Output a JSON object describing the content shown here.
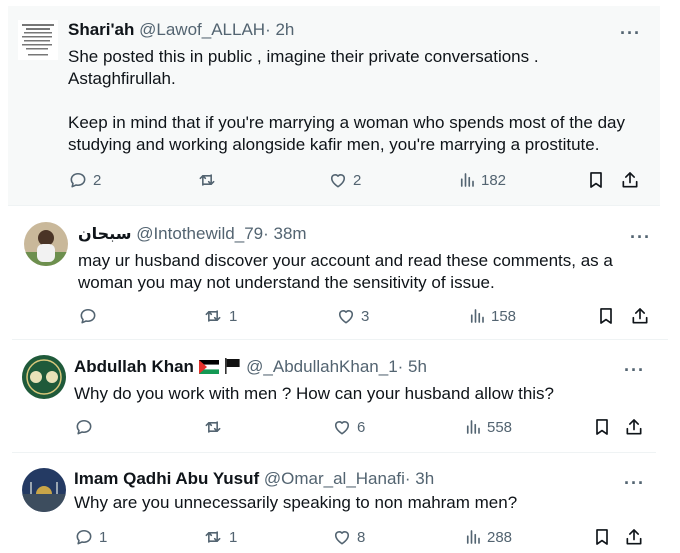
{
  "tweets": [
    {
      "name": "Shari'ah",
      "handle": "@Lawof_ALLAH",
      "time": "· 2h",
      "text": "She posted this in public , imagine their private conversations .\nAstaghfirullah.\n\nKeep in mind that if you're marrying a woman who spends most of the day studying and working alongside kafir men,  you're marrying a prostitute.",
      "replies": "2",
      "reposts": "",
      "likes": "2",
      "views": "182"
    },
    {
      "name": "سبحان",
      "handle": "@Intothewild_79",
      "time": "· 38m",
      "text": "may ur husband discover your account and read these comments, as a woman you may not understand the sensitivity of issue.",
      "replies": "",
      "reposts": "1",
      "likes": "3",
      "views": "158"
    },
    {
      "name": "Abdullah Khan",
      "handle": "@_AbdullahKhan_1",
      "time": "· 5h",
      "text": "Why do you work with men ? How can your husband allow this?",
      "replies": "",
      "reposts": "",
      "likes": "6",
      "views": "558"
    },
    {
      "name": "Imam Qadhi Abu Yusuf",
      "handle": "@Omar_al_Hanafi",
      "time": "· 3h",
      "text": "Why are you unnecessarily speaking to non mahram men?",
      "replies": "1",
      "reposts": "1",
      "likes": "8",
      "views": "288"
    }
  ],
  "more_label": "···",
  "icons": [
    "reply-icon",
    "repost-icon",
    "like-icon",
    "views-icon",
    "bookmark-icon",
    "share-icon",
    "more-icon"
  ]
}
